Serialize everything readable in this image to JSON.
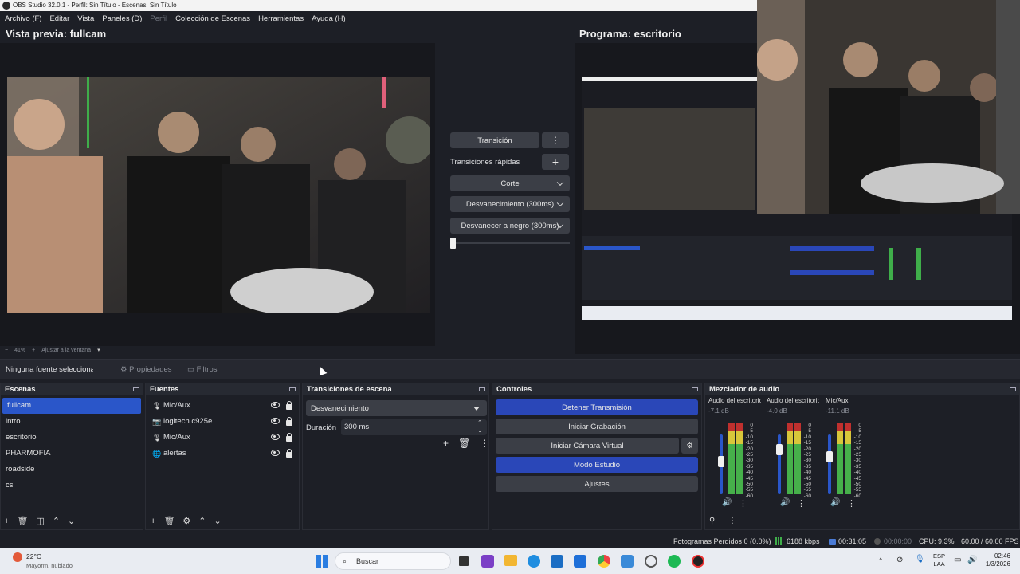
{
  "window": {
    "title": "OBS Studio 32.0.1 - Perfil: Sin Título - Escenas: Sin Título"
  },
  "menu": [
    "Archivo (F)",
    "Editar",
    "Vista",
    "Paneles (D)",
    "Perfil",
    "Colección de Escenas",
    "Herramientas",
    "Ayuda (H)"
  ],
  "preview": {
    "title": "Vista previa: fullcam"
  },
  "program": {
    "title": "Programa: escritorio"
  },
  "transition_panel": {
    "transition_label": "Transición",
    "quick_label": "Transiciones rápidas",
    "items": [
      "Corte",
      "Desvanecimiento (300ms)",
      "Desvanecer a negro (300ms)"
    ]
  },
  "zoom": {
    "level": "41%",
    "fit_label": "Ajustar a la ventana"
  },
  "context": {
    "no_source": "Ninguna fuente seleccionada",
    "properties": "Propiedades",
    "filters": "Filtros"
  },
  "scenes": {
    "title": "Escenas",
    "items": [
      "fullcam",
      "intro",
      "escritorio",
      "PHARMOFIA",
      "roadside",
      "cs"
    ],
    "selected": "fullcam"
  },
  "sources": {
    "title": "Fuentes",
    "items": [
      {
        "name": "Mic/Aux",
        "icon": "microphone-icon"
      },
      {
        "name": "logitech c925e",
        "icon": "camera-icon"
      },
      {
        "name": "Mic/Aux",
        "icon": "microphone-icon"
      },
      {
        "name": "alertas",
        "icon": "globe-icon"
      }
    ]
  },
  "scene_transitions": {
    "title": "Transiciones de escena",
    "selected": "Desvanecimiento",
    "duration_label": "Duración",
    "duration_value": "300 ms"
  },
  "controls": {
    "title": "Controles",
    "stop_stream": "Detener Transmisión",
    "start_recording": "Iniciar Grabación",
    "start_virtual_cam": "Iniciar Cámara Virtual",
    "studio_mode": "Modo Estudio",
    "settings": "Ajustes"
  },
  "mixer": {
    "title": "Mezclador de audio",
    "channels": [
      {
        "name": "Audio del escritorio",
        "db": "-7.1 dB",
        "level": 0.55
      },
      {
        "name": "Audio del escritorio",
        "db": "-4.0 dB",
        "level": 0.8
      },
      {
        "name": "Mic/Aux",
        "db": "-11.1 dB",
        "level": 0.65
      }
    ],
    "scale": [
      "0",
      "-5",
      "-10",
      "-15",
      "-20",
      "-25",
      "-30",
      "-35",
      "-40",
      "-45",
      "-50",
      "-55",
      "-60"
    ]
  },
  "status": {
    "dropped_frames": "Fotogramas Perdidos 0 (0.0%)",
    "bitrate": "6188 kbps",
    "stream_time": "00:31:05",
    "rec_time": "00:00:00",
    "cpu": "CPU: 9.3%",
    "fps": "60.00 / 60.00 FPS"
  },
  "taskbar": {
    "temp": "22°C",
    "weather": "Mayorm. nublado",
    "search": "Buscar",
    "lang1": "ESP",
    "lang2": "LAA",
    "time": "02:46",
    "date": "1/3/2026"
  },
  "colors": {
    "accent": "#2a47b8",
    "selected": "#2a56c9",
    "bg": "#1d1f26"
  }
}
